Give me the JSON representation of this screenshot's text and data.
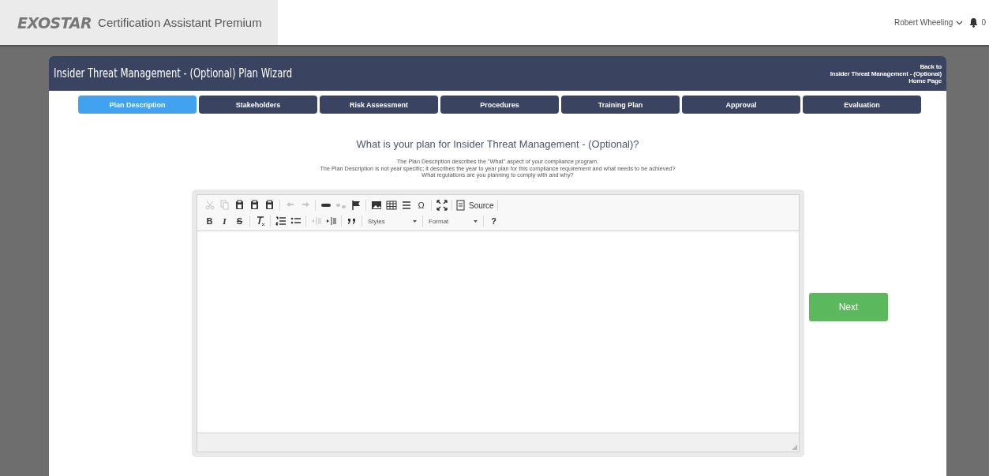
{
  "brand": {
    "logo": "EXOSTAR",
    "product": "Certification Assistant Premium"
  },
  "user": {
    "name": "Robert Wheeling",
    "notifications": "0"
  },
  "wizard": {
    "title": "Insider Threat Management - (Optional) Plan Wizard",
    "back_link": [
      "Back to",
      "Insider Threat Management - (Optional)",
      "Home Page"
    ]
  },
  "tabs": [
    {
      "label": "Plan Description",
      "selected": true
    },
    {
      "label": "Stakeholders",
      "selected": false
    },
    {
      "label": "Risk Assessment",
      "selected": false
    },
    {
      "label": "Procedures",
      "selected": false
    },
    {
      "label": "Training Plan",
      "selected": false
    },
    {
      "label": "Approval",
      "selected": false
    },
    {
      "label": "Evaluation",
      "selected": false
    }
  ],
  "question": "What is your plan for Insider Threat Management - (Optional)?",
  "description": [
    "The Plan Description describes the \"What\" aspect of your compliance program.",
    "The Plan Description is not year specific; it describes the year to year plan for this compliance requirement and what needs to be achieved?",
    "What regulations are you planning to comply with and why?"
  ],
  "toolbar": [
    [
      {
        "kind": "cut",
        "disabled": true
      },
      {
        "kind": "copy",
        "disabled": true
      },
      {
        "kind": "paste",
        "disabled": false
      },
      {
        "kind": "paste-text",
        "disabled": false
      },
      {
        "kind": "paste-word",
        "disabled": false
      },
      {
        "kind": "sep"
      },
      {
        "kind": "undo",
        "disabled": true
      },
      {
        "kind": "redo",
        "disabled": true
      },
      {
        "kind": "sep"
      },
      {
        "kind": "link",
        "disabled": false
      },
      {
        "kind": "unlink",
        "disabled": true
      },
      {
        "kind": "anchor",
        "disabled": false
      },
      {
        "kind": "sep"
      },
      {
        "kind": "image",
        "disabled": false
      },
      {
        "kind": "table",
        "disabled": false
      },
      {
        "kind": "rule",
        "disabled": false
      },
      {
        "kind": "glyph",
        "label": "Ω",
        "disabled": false
      },
      {
        "kind": "sep"
      },
      {
        "kind": "maximize",
        "disabled": false
      },
      {
        "kind": "sep"
      },
      {
        "kind": "source",
        "label": "Source",
        "disabled": false
      },
      {
        "kind": "sep"
      }
    ],
    [
      {
        "kind": "bold",
        "label": "B",
        "disabled": false
      },
      {
        "kind": "italic",
        "label": "I",
        "disabled": false
      },
      {
        "kind": "strike",
        "label": "S",
        "disabled": false
      },
      {
        "kind": "sep"
      },
      {
        "kind": "clear-format",
        "disabled": false
      },
      {
        "kind": "sep"
      },
      {
        "kind": "numbered-list",
        "disabled": false
      },
      {
        "kind": "bulleted-list",
        "disabled": false
      },
      {
        "kind": "sep"
      },
      {
        "kind": "outdent",
        "disabled": true
      },
      {
        "kind": "indent",
        "disabled": false
      },
      {
        "kind": "sep"
      },
      {
        "kind": "blockquote",
        "disabled": false
      },
      {
        "kind": "sep"
      },
      {
        "kind": "combo",
        "label": "Styles"
      },
      {
        "kind": "sep"
      },
      {
        "kind": "combo",
        "label": "Format"
      },
      {
        "kind": "sep"
      },
      {
        "kind": "help",
        "label": "?",
        "disabled": false
      }
    ]
  ],
  "next_button": "Next"
}
